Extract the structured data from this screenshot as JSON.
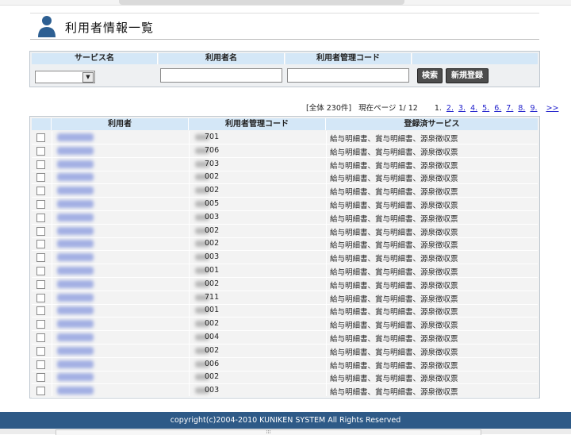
{
  "page": {
    "title": "利用者情報一覧"
  },
  "search": {
    "headers": {
      "service": "サービス名",
      "user": "利用者名",
      "code": "利用者管理コード"
    },
    "service_selected": "",
    "user_value": "",
    "code_value": "",
    "search_label": "検索",
    "new_label": "新規登録"
  },
  "pager": {
    "total": "[全体 230件]",
    "current": "現在ページ 1/ 12",
    "pages": [
      "1.",
      "2.",
      "3.",
      "4.",
      "5.",
      "6.",
      "7.",
      "8.",
      "9."
    ],
    "next": ">>"
  },
  "table": {
    "headers": {
      "user": "利用者",
      "code": "利用者管理コード",
      "services": "登録済サービス"
    },
    "rows": [
      {
        "code": "701",
        "services": "給与明細書、賞与明細書、源泉徴収票"
      },
      {
        "code": "706",
        "services": "給与明細書、賞与明細書、源泉徴収票"
      },
      {
        "code": "703",
        "services": "給与明細書、賞与明細書、源泉徴収票"
      },
      {
        "code": "002",
        "services": "給与明細書、賞与明細書、源泉徴収票"
      },
      {
        "code": "002",
        "services": "給与明細書、賞与明細書、源泉徴収票"
      },
      {
        "code": "005",
        "services": "給与明細書、賞与明細書、源泉徴収票"
      },
      {
        "code": "003",
        "services": "給与明細書、賞与明細書、源泉徴収票"
      },
      {
        "code": "002",
        "services": "給与明細書、賞与明細書、源泉徴収票"
      },
      {
        "code": "002",
        "services": "給与明細書、賞与明細書、源泉徴収票"
      },
      {
        "code": "003",
        "services": "給与明細書、賞与明細書、源泉徴収票"
      },
      {
        "code": "001",
        "services": "給与明細書、賞与明細書、源泉徴収票"
      },
      {
        "code": "002",
        "services": "給与明細書、賞与明細書、源泉徴収票"
      },
      {
        "code": "711",
        "services": "給与明細書、賞与明細書、源泉徴収票"
      },
      {
        "code": "001",
        "services": "給与明細書、賞与明細書、源泉徴収票"
      },
      {
        "code": "002",
        "services": "給与明細書、賞与明細書、源泉徴収票"
      },
      {
        "code": "004",
        "services": "給与明細書、賞与明細書、源泉徴収票"
      },
      {
        "code": "002",
        "services": "給与明細書、賞与明細書、源泉徴収票"
      },
      {
        "code": "006",
        "services": "給与明細書、賞与明細書、源泉徴収票"
      },
      {
        "code": "002",
        "services": "給与明細書、賞与明細書、源泉徴収票"
      },
      {
        "code": "003",
        "services": "給与明細書、賞与明細書、源泉徴収票"
      }
    ]
  },
  "footer": {
    "copyright": "copyright(c)2004-2010 KUNIKEN SYSTEM All Rights Reserved"
  },
  "statusbar": {
    "grip": "⁝⁝⁝"
  },
  "colors": {
    "header_bg": "#d4e7f7",
    "footer_bg": "#2e5a87",
    "button_bg": "#4d4d4d",
    "link": "#2222cc"
  }
}
